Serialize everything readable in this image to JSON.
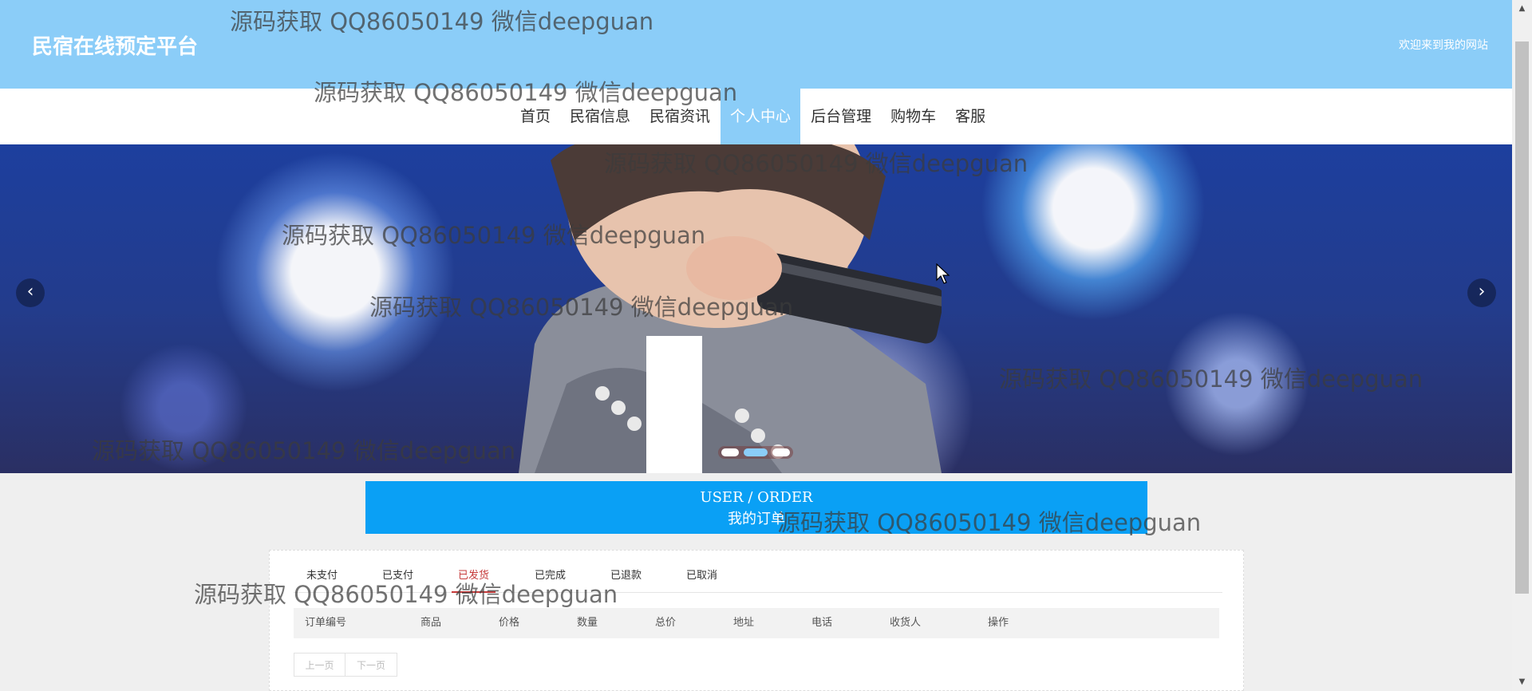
{
  "header": {
    "site_title": "民宿在线预定平台",
    "welcome": "欢迎来到我的网站"
  },
  "nav": {
    "items": [
      {
        "label": "首页"
      },
      {
        "label": "民宿信息"
      },
      {
        "label": "民宿资讯"
      },
      {
        "label": "个人中心",
        "active": true
      },
      {
        "label": "后台管理"
      },
      {
        "label": "购物车"
      },
      {
        "label": "客服"
      }
    ]
  },
  "carousel": {
    "prev_icon": "chevron-left-icon",
    "next_icon": "chevron-right-icon",
    "slide_count": 3,
    "active_slide": 2
  },
  "section_title": {
    "en": "USER / ORDER",
    "cn": "我的订单"
  },
  "orders": {
    "tabs": [
      "未支付",
      "已支付",
      "已发货",
      "已完成",
      "已退款",
      "已取消"
    ],
    "active_tab": "已发货",
    "columns": [
      "订单编号",
      "商品",
      "价格",
      "数量",
      "总价",
      "地址",
      "电话",
      "收货人",
      "操作"
    ],
    "rows": [],
    "pager": {
      "prev": "上一页",
      "next": "下一页"
    }
  },
  "watermark": {
    "text": "源码获取 QQ86050149 微信deepguan"
  },
  "colors": {
    "header_bg": "#8bcdf8",
    "title_box_bg": "#0aa0f5",
    "active_tab": "#c63a3a"
  }
}
